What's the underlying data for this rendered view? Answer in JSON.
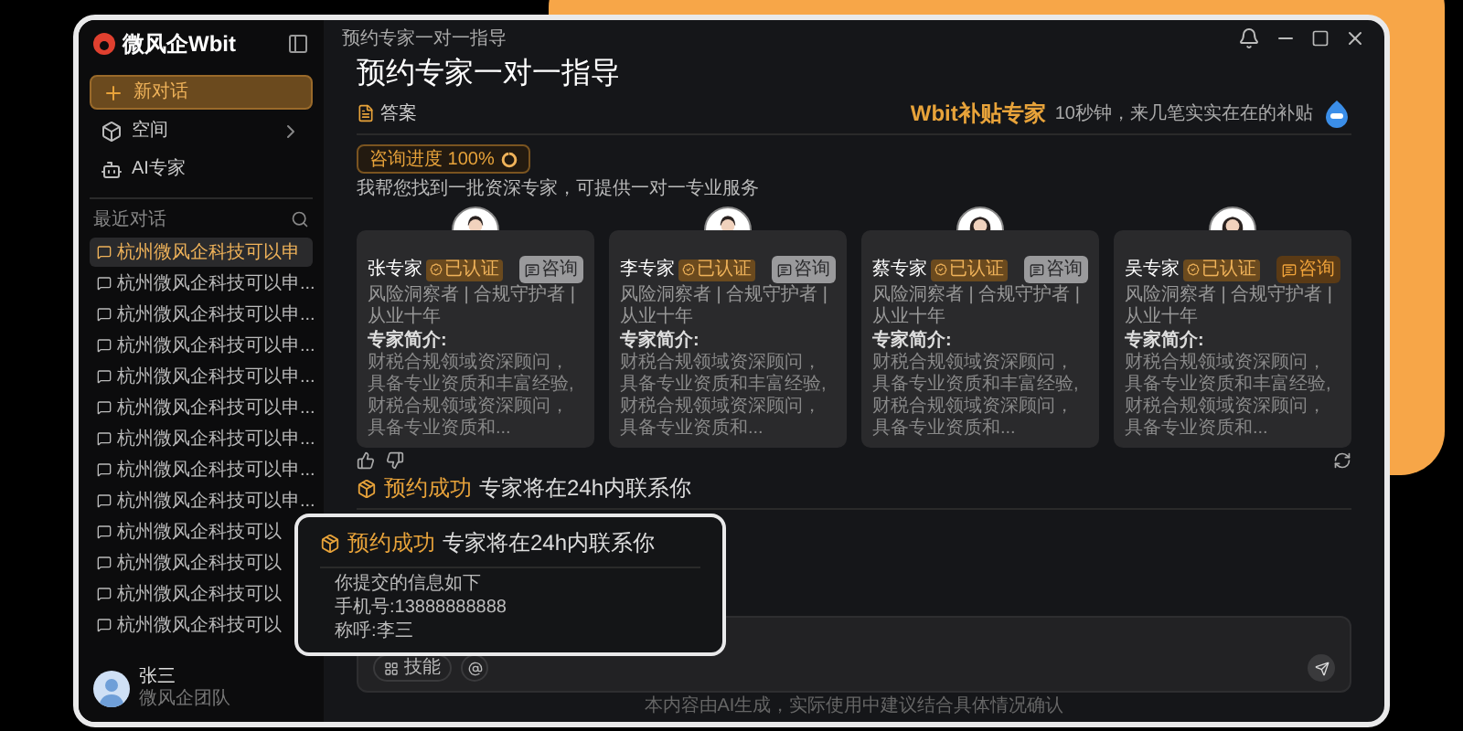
{
  "window": {
    "title": "预约专家一对一指导"
  },
  "sidebar": {
    "logo": "微风企Wbit",
    "nav": [
      {
        "label": "新对话",
        "kind": "new",
        "selected": true
      },
      {
        "label": "空间",
        "kind": "expand",
        "selected": false
      },
      {
        "label": "AI专家",
        "kind": "plain",
        "selected": false
      }
    ],
    "recent_label": "最近对话",
    "conversations": [
      {
        "title": "杭州微风企科技可以申",
        "selected": true
      },
      {
        "title": "杭州微风企科技可以申...",
        "selected": false
      },
      {
        "title": "杭州微风企科技可以申...",
        "selected": false
      },
      {
        "title": "杭州微风企科技可以申...",
        "selected": false
      },
      {
        "title": "杭州微风企科技可以申...",
        "selected": false
      },
      {
        "title": "杭州微风企科技可以申...",
        "selected": false
      },
      {
        "title": "杭州微风企科技可以申...",
        "selected": false
      },
      {
        "title": "杭州微风企科技可以申...",
        "selected": false
      },
      {
        "title": "杭州微风企科技可以申...",
        "selected": false
      },
      {
        "title": "杭州微风企科技可以",
        "selected": false
      },
      {
        "title": "杭州微风企科技可以",
        "selected": false
      },
      {
        "title": "杭州微风企科技可以",
        "selected": false
      },
      {
        "title": "杭州微风企科技可以",
        "selected": false
      }
    ],
    "user": {
      "name": "张三",
      "team": "微风企团队"
    }
  },
  "page": {
    "heading": "预约专家一对一指导",
    "tab": "答案",
    "promo": {
      "title": "Wbit补贴专家",
      "subtitle": "10秒钟，来几笔实实在在的补贴"
    },
    "progress": {
      "label": "咨询进度 100%",
      "level": 1
    },
    "intro": "我帮您找到一批资深专家，可提供一对一专业服务"
  },
  "experts": [
    {
      "name": "张专家",
      "kind": "male",
      "badge": "已认证",
      "consult": "咨询",
      "selected": false,
      "tags": "风险洞察者 | 合规守护者 | 从业十年",
      "intro_label": "专家简介:",
      "description": "财税合规领域资深顾问，具备专业资质和丰富经验,财税合规领域资深顾问，具备专业资质和..."
    },
    {
      "name": "李专家",
      "kind": "male",
      "badge": "已认证",
      "consult": "咨询",
      "selected": false,
      "tags": "风险洞察者 | 合规守护者 | 从业十年",
      "intro_label": "专家简介:",
      "description": "财税合规领域资深顾问，具备专业资质和丰富经验,财税合规领域资深顾问，具备专业资质和..."
    },
    {
      "name": "蔡专家",
      "kind": "female",
      "badge": "已认证",
      "consult": "咨询",
      "selected": false,
      "tags": "风险洞察者 | 合规守护者 | 从业十年",
      "intro_label": "专家简介:",
      "description": "财税合规领域资深顾问，具备专业资质和丰富经验,财税合规领域资深顾问，具备专业资质和..."
    },
    {
      "name": "吴专家",
      "kind": "female",
      "badge": "已认证",
      "consult": "咨询",
      "selected": true,
      "tags": "风险洞察者 | 合规守护者 | 从业十年",
      "intro_label": "专家简介:",
      "description": "财税合规领域资深顾问，具备专业资质和丰富经验,财税合规领域资深顾问，具备专业资质和..."
    }
  ],
  "result": {
    "status": "预约成功",
    "message": "专家将在24h内联系你"
  },
  "popup": {
    "status": "预约成功",
    "message": "专家将在24h内联系你",
    "lines": [
      "你提交的信息如下",
      "手机号:13888888888",
      "称呼:李三"
    ]
  },
  "composer": {
    "skill": "技能"
  },
  "footer": "本内容由AI生成，实际使用中建议结合具体情况确认"
}
